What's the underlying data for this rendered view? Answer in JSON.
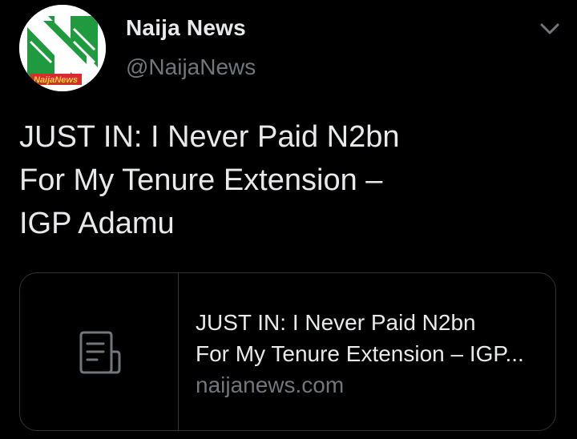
{
  "author": {
    "display_name": "Naija News",
    "handle": "@NaijaNews",
    "avatar_text": "NaijaNews"
  },
  "tweet": {
    "lines": [
      "JUST IN: I Never Paid N2bn",
      "For My Tenure Extension –",
      "IGP Adamu"
    ]
  },
  "link_card": {
    "title_lines": [
      "JUST IN: I Never Paid N2bn",
      "For My Tenure Extension – IGP..."
    ],
    "domain": "naijanews.com",
    "thumb_icon": "document-icon"
  },
  "icons": {
    "more": "chevron-down-icon",
    "avatar": "naija-news-logo"
  },
  "colors": {
    "background": "#000000",
    "primary_text": "#e7e9ea",
    "secondary_text": "#71767b",
    "border": "#2f3336",
    "brand_green": "#1f9a3e"
  }
}
